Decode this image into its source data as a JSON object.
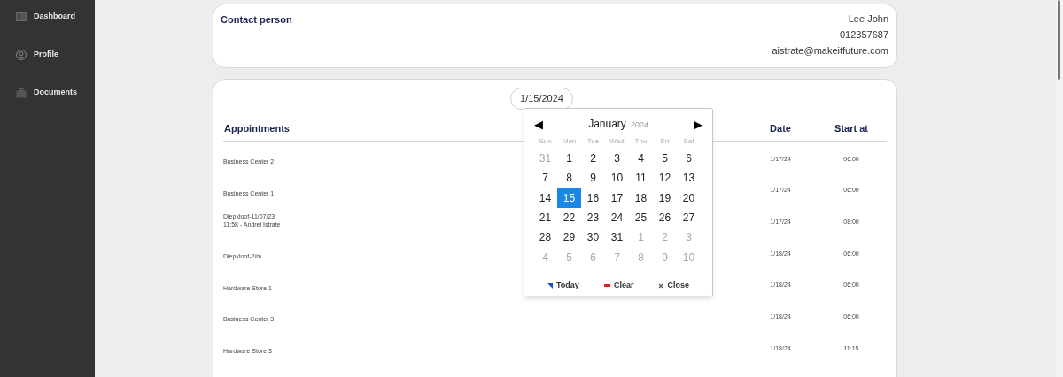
{
  "sidebar": {
    "items": [
      {
        "label": "Dashboard",
        "kind": "dashboard"
      },
      {
        "label": "Profile",
        "kind": "profile"
      },
      {
        "label": "Documents",
        "kind": "documents"
      }
    ]
  },
  "contact": {
    "title": "Contact person",
    "name": "Lee John",
    "phone": "012357687",
    "email": "aistrate@makeitfuture.com"
  },
  "date_field": {
    "value": "1/15/2024"
  },
  "calendar": {
    "month": "January",
    "year": "2024",
    "prev": "◀",
    "next": "▶",
    "weekdays": [
      "Sun",
      "Mon",
      "Tue",
      "Wed",
      "Thu",
      "Fri",
      "Sat"
    ],
    "days": [
      {
        "label": "31",
        "muted": true,
        "selected": false
      },
      {
        "label": "1",
        "muted": false,
        "selected": false
      },
      {
        "label": "2",
        "muted": false,
        "selected": false
      },
      {
        "label": "3",
        "muted": false,
        "selected": false
      },
      {
        "label": "4",
        "muted": false,
        "selected": false
      },
      {
        "label": "5",
        "muted": false,
        "selected": false
      },
      {
        "label": "6",
        "muted": false,
        "selected": false
      },
      {
        "label": "7",
        "muted": false,
        "selected": false
      },
      {
        "label": "8",
        "muted": false,
        "selected": false
      },
      {
        "label": "9",
        "muted": false,
        "selected": false
      },
      {
        "label": "10",
        "muted": false,
        "selected": false
      },
      {
        "label": "11",
        "muted": false,
        "selected": false
      },
      {
        "label": "12",
        "muted": false,
        "selected": false
      },
      {
        "label": "13",
        "muted": false,
        "selected": false
      },
      {
        "label": "14",
        "muted": false,
        "selected": false
      },
      {
        "label": "15",
        "muted": false,
        "selected": true
      },
      {
        "label": "16",
        "muted": false,
        "selected": false
      },
      {
        "label": "17",
        "muted": false,
        "selected": false
      },
      {
        "label": "18",
        "muted": false,
        "selected": false
      },
      {
        "label": "19",
        "muted": false,
        "selected": false
      },
      {
        "label": "20",
        "muted": false,
        "selected": false
      },
      {
        "label": "21",
        "muted": false,
        "selected": false
      },
      {
        "label": "22",
        "muted": false,
        "selected": false
      },
      {
        "label": "23",
        "muted": false,
        "selected": false
      },
      {
        "label": "24",
        "muted": false,
        "selected": false
      },
      {
        "label": "25",
        "muted": false,
        "selected": false
      },
      {
        "label": "26",
        "muted": false,
        "selected": false
      },
      {
        "label": "27",
        "muted": false,
        "selected": false
      },
      {
        "label": "28",
        "muted": false,
        "selected": false
      },
      {
        "label": "29",
        "muted": false,
        "selected": false
      },
      {
        "label": "30",
        "muted": false,
        "selected": false
      },
      {
        "label": "31",
        "muted": false,
        "selected": false
      },
      {
        "label": "1",
        "muted": true,
        "selected": false
      },
      {
        "label": "2",
        "muted": true,
        "selected": false
      },
      {
        "label": "3",
        "muted": true,
        "selected": false
      },
      {
        "label": "4",
        "muted": true,
        "selected": false
      },
      {
        "label": "5",
        "muted": true,
        "selected": false
      },
      {
        "label": "6",
        "muted": true,
        "selected": false
      },
      {
        "label": "7",
        "muted": true,
        "selected": false
      },
      {
        "label": "8",
        "muted": true,
        "selected": false
      },
      {
        "label": "9",
        "muted": true,
        "selected": false
      },
      {
        "label": "10",
        "muted": true,
        "selected": false
      }
    ],
    "buttons": [
      {
        "label": "Today",
        "kind": "today"
      },
      {
        "label": "Clear",
        "kind": "clear"
      },
      {
        "label": "Close",
        "kind": "close"
      }
    ]
  },
  "table": {
    "columns": [
      "Appointments",
      "Date",
      "Start at"
    ],
    "rows": [
      {
        "appointment": "Business Center 2",
        "date": "1/17/24",
        "start": "06:00"
      },
      {
        "appointment": "Business Center 1",
        "date": "1/17/24",
        "start": "06:00"
      },
      {
        "appointment": "Diepkloof-11/07/23\n11:58 - Andrei Istrate",
        "date": "1/17/24",
        "start": "08:00"
      },
      {
        "appointment": "Diepkloof-2/m",
        "date": "1/18/24",
        "start": "06:00"
      },
      {
        "appointment": "Hardware Store 1",
        "date": "1/18/24",
        "start": "06:00"
      },
      {
        "appointment": "Business Center 3",
        "date": "1/18/24",
        "start": "06:00"
      },
      {
        "appointment": "Hardware Store 3",
        "date": "1/18/24",
        "start": "11:15"
      }
    ]
  }
}
